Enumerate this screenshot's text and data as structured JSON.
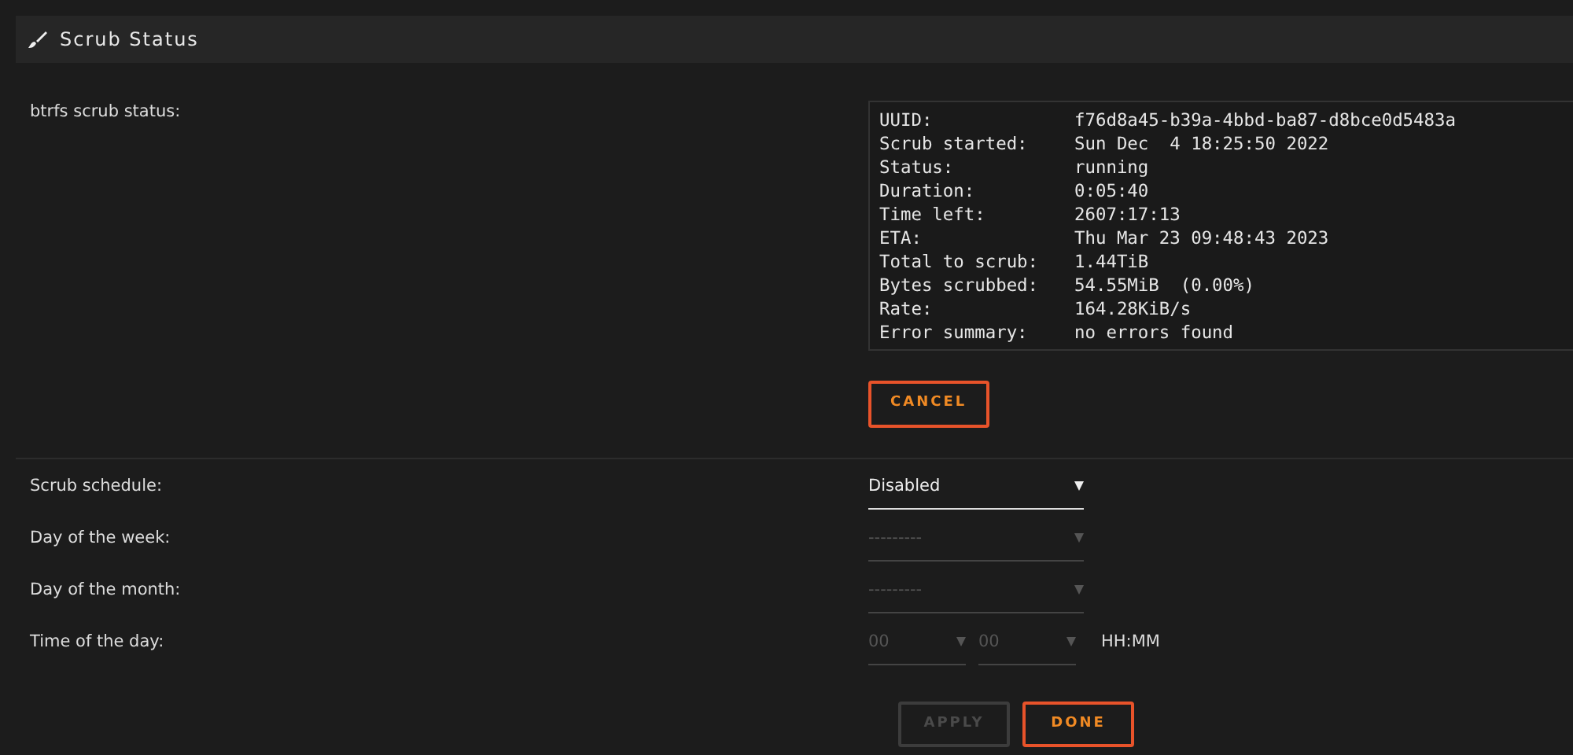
{
  "panel": {
    "title": "Scrub Status"
  },
  "status": {
    "label": "btrfs scrub status:",
    "rows": [
      {
        "label": "UUID:",
        "value": "f76d8a45-b39a-4bbd-ba87-d8bce0d5483a"
      },
      {
        "label": "Scrub started:",
        "value": "Sun Dec  4 18:25:50 2022"
      },
      {
        "label": "Status:",
        "value": "running"
      },
      {
        "label": "Duration:",
        "value": "0:05:40"
      },
      {
        "label": "Time left:",
        "value": "2607:17:13"
      },
      {
        "label": "ETA:",
        "value": "Thu Mar 23 09:48:43 2023"
      },
      {
        "label": "Total to scrub:",
        "value": "1.44TiB"
      },
      {
        "label": "Bytes scrubbed:",
        "value": "54.55MiB  (0.00%)"
      },
      {
        "label": "Rate:",
        "value": "164.28KiB/s"
      },
      {
        "label": "Error summary:",
        "value": "no errors found"
      }
    ],
    "button": {
      "label": "CANCEL",
      "disabled": false
    }
  },
  "schedule": [
    {
      "label": "Scrub schedule:",
      "selects": [
        {
          "value": "Disabled",
          "disabled": false
        }
      ]
    },
    {
      "label": "Day of the week:",
      "selects": [
        {
          "value": "---------",
          "disabled": true
        }
      ]
    },
    {
      "label": "Day of the month:",
      "selects": [
        {
          "value": "---------",
          "disabled": true
        }
      ]
    },
    {
      "label": "Time of the day:",
      "selects": [
        {
          "value": "00",
          "disabled": true
        },
        {
          "value": "00",
          "disabled": true
        }
      ],
      "suffix": "HH:MM"
    }
  ],
  "buttons": [
    {
      "label": "APPLY",
      "disabled": true
    },
    {
      "label": "DONE",
      "disabled": false
    }
  ]
}
